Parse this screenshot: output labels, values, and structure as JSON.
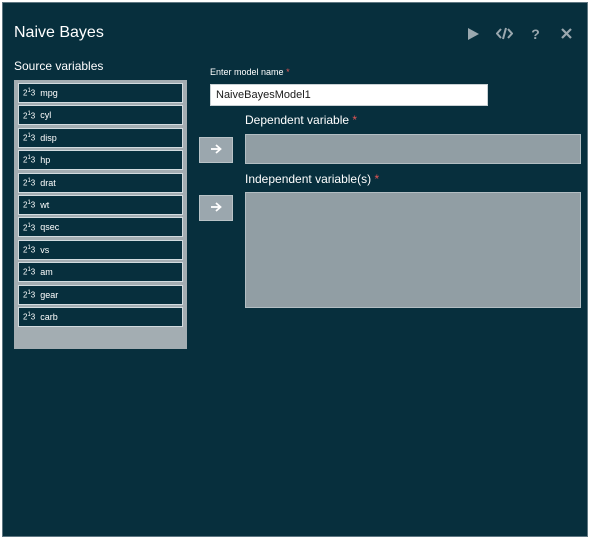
{
  "window": {
    "title": "Naive Bayes"
  },
  "toolbar": {
    "icons": [
      "run-icon",
      "code-icon",
      "help-icon",
      "close-icon"
    ],
    "help_glyph": "?"
  },
  "source": {
    "label": "Source variables",
    "items": [
      {
        "label": "mpg"
      },
      {
        "label": "cyl"
      },
      {
        "label": "disp"
      },
      {
        "label": "hp"
      },
      {
        "label": "drat"
      },
      {
        "label": "wt"
      },
      {
        "label": "qsec"
      },
      {
        "label": "vs"
      },
      {
        "label": "am"
      },
      {
        "label": "gear"
      },
      {
        "label": "carb"
      }
    ]
  },
  "model": {
    "label": "Enter model name",
    "required": "*",
    "value": "NaiveBayesModel1"
  },
  "dependent": {
    "label": "Dependent variable",
    "required": "*"
  },
  "independent": {
    "label": "Independent variable(s)",
    "required": "*"
  },
  "colors": {
    "background": "#072f3d",
    "panel": "#a3adb2",
    "required": "#e25555"
  }
}
